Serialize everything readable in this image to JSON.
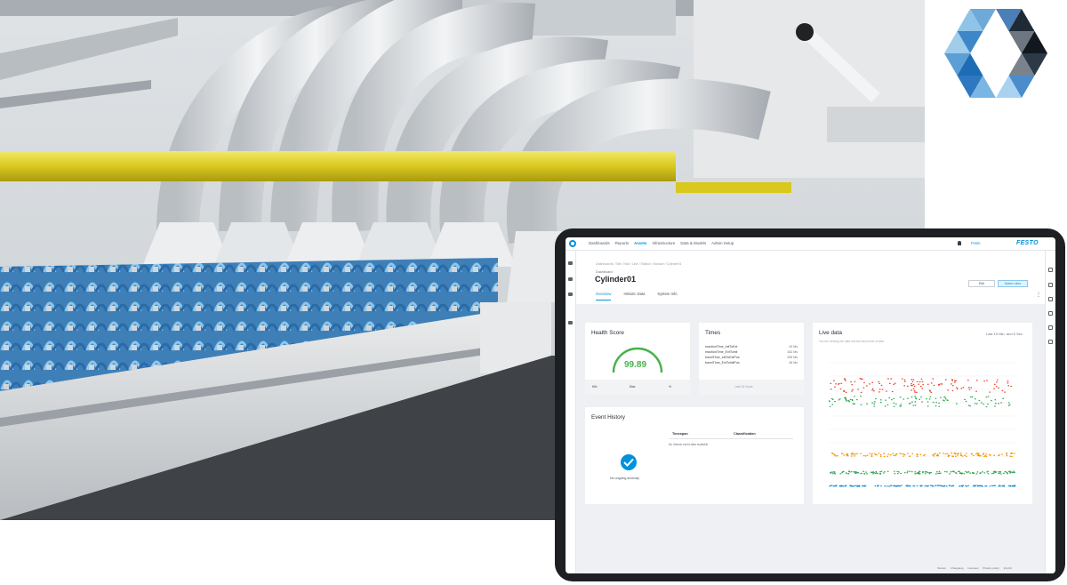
{
  "app": {
    "nav": [
      "Dashboards",
      "Reports",
      "Assets",
      "Infrastructure",
      "Data & Models",
      "Admin Setup"
    ],
    "active_nav": "Assets",
    "user": "Festo",
    "brand": "FESTO"
  },
  "header": {
    "breadcrumb": "Dashboards / Site / Hall / Line / Station / Module / Cylinder01",
    "section_label": "Dashboard",
    "title": "Cylinder01",
    "tabs": [
      "Overview",
      "Historic Data",
      "System Info"
    ],
    "active_tab": "Overview",
    "edit_button": "Edit",
    "alert_button": "Alarm rules"
  },
  "health": {
    "title": "Health Score",
    "value": "99.89",
    "percent": 99.89,
    "min": "Min",
    "max": "Max",
    "unit": "%"
  },
  "times": {
    "title": "Times",
    "rows": [
      {
        "label": "reactionTime_InitToExt",
        "value": "43 Ms"
      },
      {
        "label": "reactionTime_ExtToInit",
        "value": "162 Ms"
      },
      {
        "label": "travelTime_InitToExtPos",
        "value": "256 Ms"
      },
      {
        "label": "travelTime_ExtToInitPos",
        "value": "46 Ms"
      }
    ],
    "footer": "Last 24 hours"
  },
  "live": {
    "title": "Live data",
    "range": "Last 15 Min. and 5 Sec.",
    "subtitle": "You are viewing live data and the last period of data",
    "colors": {
      "red": "#e8442e",
      "green": "#2fa84f",
      "orange": "#f39200",
      "blue": "#1a8fd8"
    }
  },
  "events": {
    "title": "Event History",
    "col_timespan": "Timespan",
    "col_classification": "Classification",
    "empty_table": "No historic event data available",
    "status": "No ongoing anomaly"
  },
  "footer": [
    "Version",
    "Changelog",
    "Licenses",
    "Privacy policy",
    "Imprint"
  ]
}
